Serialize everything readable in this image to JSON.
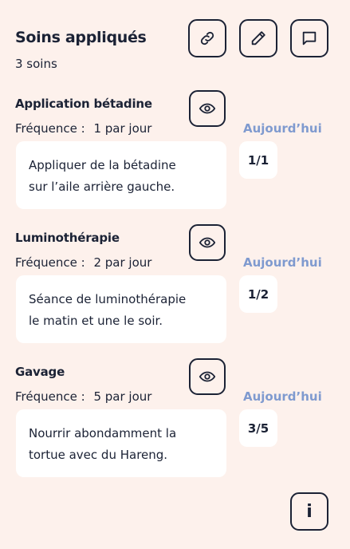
{
  "header": {
    "title": "Soins appliqués",
    "subtitle": "3 soins"
  },
  "actions": {
    "link_icon": "link-icon",
    "edit_icon": "pencil-icon",
    "comment_icon": "comment-icon",
    "info_label": "i"
  },
  "colors": {
    "background": "#FDF1EC",
    "text": "#1B2235",
    "accent": "#7F9ACF",
    "card": "#FFFFFF"
  },
  "cares": [
    {
      "name": "Application bétadine",
      "frequency_label": "Fréquence :",
      "frequency_value": "1 par jour",
      "today_label": "Aujourd’hui",
      "note_line1": "Appliquer de la bétadine",
      "note_line2": "sur l’aile arrière gauche.",
      "count": "1/1"
    },
    {
      "name": "Luminothérapie",
      "frequency_label": "Fréquence :",
      "frequency_value": "2 par jour",
      "today_label": "Aujourd’hui",
      "note_line1": "Séance de luminothérapie",
      "note_line2": "le matin et une le soir.",
      "count": "1/2"
    },
    {
      "name": "Gavage",
      "frequency_label": "Fréquence :",
      "frequency_value": "5 par jour",
      "today_label": "Aujourd’hui",
      "note_line1": "Nourrir abondamment la",
      "note_line2": "tortue avec du Hareng.",
      "count": "3/5"
    }
  ]
}
